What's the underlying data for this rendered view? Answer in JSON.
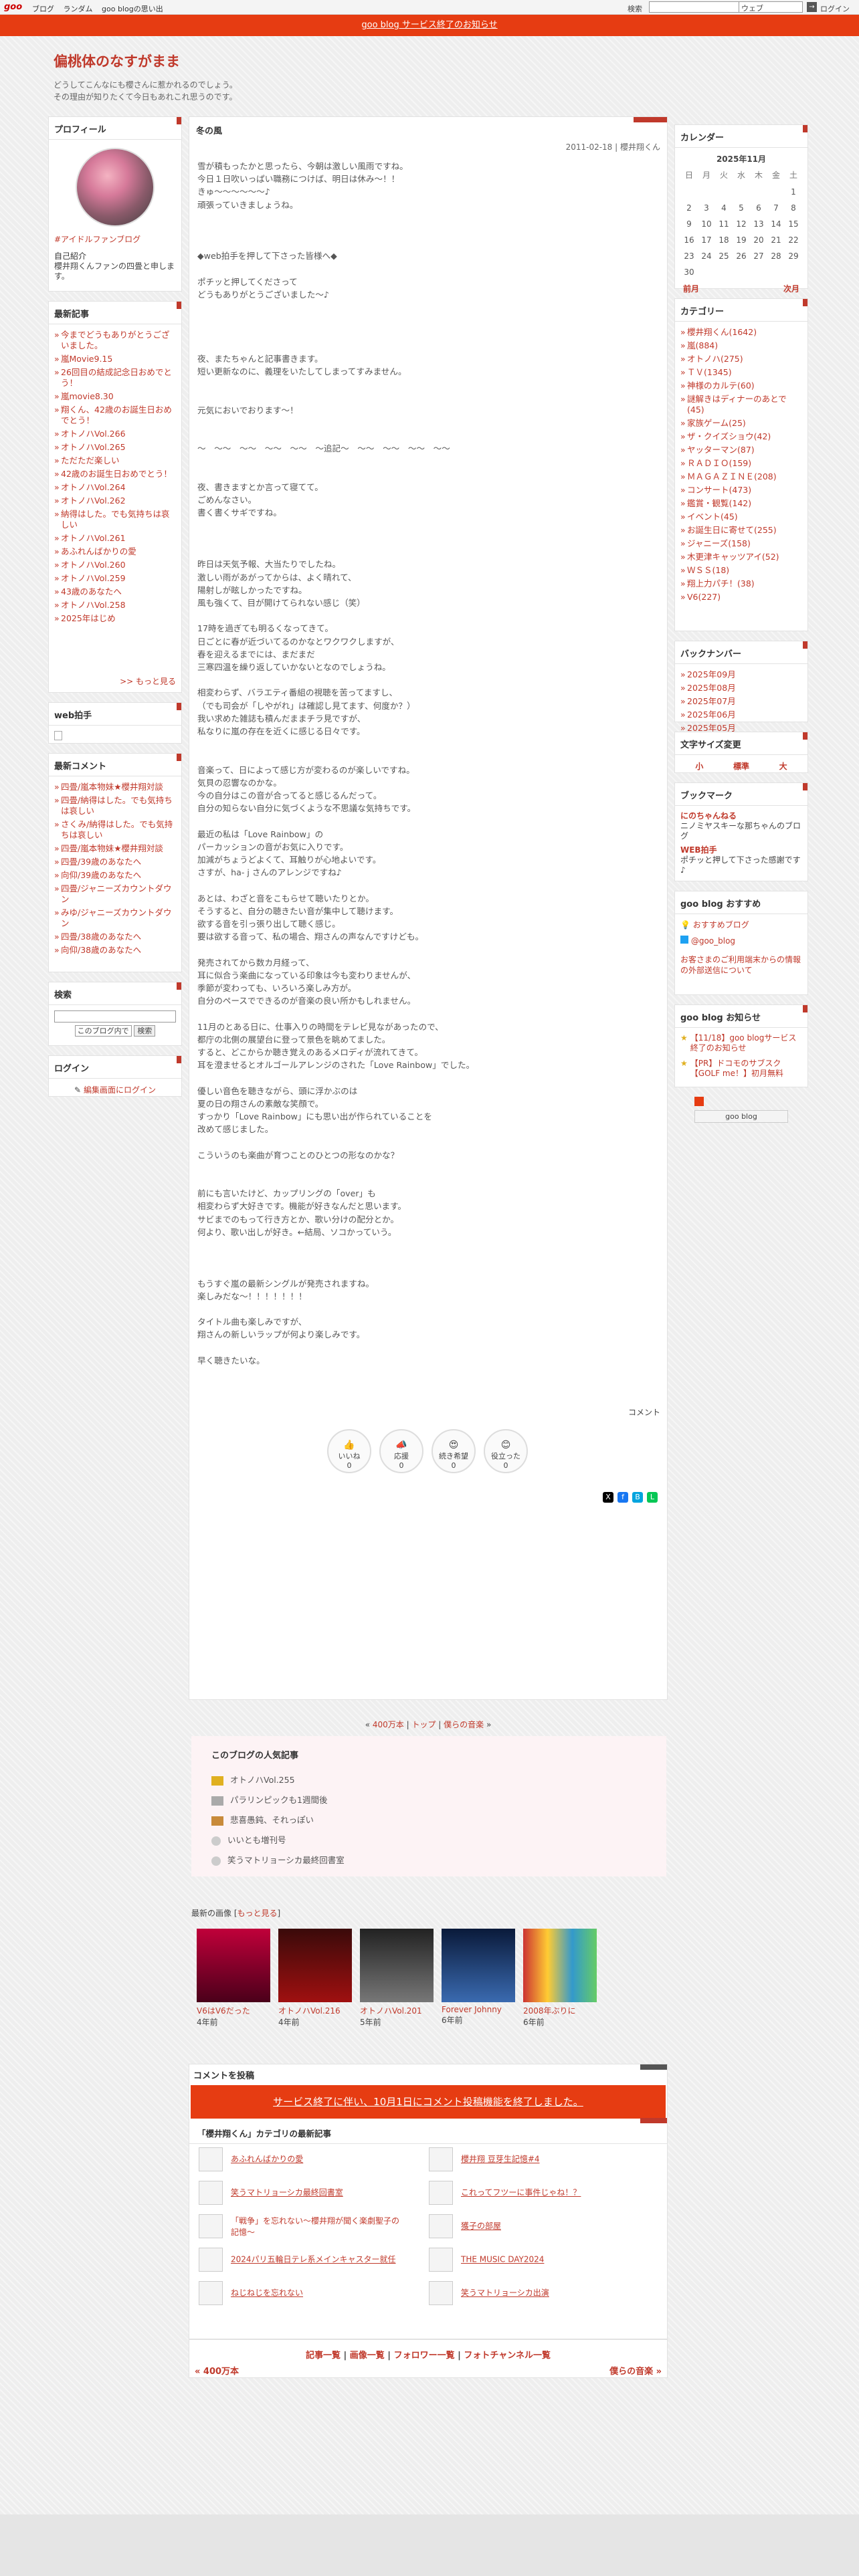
{
  "topbar": {
    "logo": "goo",
    "links": [
      "ブログ",
      "ランダム",
      "goo blogの思い出"
    ],
    "search_label": "検索",
    "search_scope": "ウェブ",
    "go": "→",
    "login": "ログイン"
  },
  "banner": "goo blog サービス終了のお知らせ",
  "blog": {
    "title": "偏桃体のなすがまま",
    "desc1": "どうしてこんなにも櫻さんに惹かれるのでしょう。",
    "desc2": "その理由が知りたくて今日もあれこれ思うのです。"
  },
  "left": {
    "profile": {
      "title": "プロフィール",
      "hashtag": "#アイドルファンブログ",
      "intro_label": "自己紹介",
      "intro": "櫻井翔くんファンの四畳と申します。"
    },
    "recent": {
      "title": "最新記事",
      "items": [
        "今までどうもありがとうございました。",
        "嵐Movie9.15",
        "26回目の結成記念日おめでとう！",
        "嵐movie8.30",
        "翔くん、42歳のお誕生日おめでとう！",
        "オトノハVol.266",
        "オトノハVol.265",
        "ただただ楽しい",
        "42歳のお誕生日おめでとう！",
        "オトノハVol.264",
        "オトノハVol.262",
        "納得はした。でも気持ちは哀しい",
        "オトノハVol.261",
        "あふれんばかりの愛",
        "オトノハVol.260",
        "オトノハVol.259",
        "43歳のあなたへ",
        "オトノハVol.258",
        "2025年はじめ"
      ],
      "more": ">> もっと見る"
    },
    "clap": {
      "title": "web拍手"
    },
    "comments": {
      "title": "最新コメント",
      "items": [
        "四畳/嵐本物妹★櫻井翔対談",
        "四畳/納得はした。でも気持ちは哀しい",
        "さくみ/納得はした。でも気持ちは哀しい",
        "四畳/嵐本物妹★櫻井翔対談",
        "四畳/39歳のあなたへ",
        "向仰/39歳のあなたへ",
        "四畳/ジャニーズカウントダウン",
        "みゆ/ジャニーズカウントダウン",
        "四畳/38歳のあなたへ",
        "向仰/38歳のあなたへ"
      ]
    },
    "search": {
      "title": "検索",
      "scope": "このブログ内で",
      "button": "検索"
    },
    "login": {
      "title": "ログイン",
      "link": "編集画面にログイン"
    }
  },
  "article": {
    "title": "冬の風",
    "date": "2011-02-18 | 櫻井翔くん",
    "body": "雪が積もったかと思ったら、今朝は激しい風雨ですね。\n今日１日吹いっぱい職務につけば、明日は休み〜！！\nきゅ〜〜〜〜〜〜♪\n頑張っていきましょうね。\n\n\n\n◆web拍手を押して下さった皆様へ◆\n\nポチッと押してくださって\nどうもありがとうございました〜♪\n\n\n\n\n夜、またちゃんと記事書きます。\n短い更新なのに、義理をいたしてしまってすみません。\n\n\n元気においでおります〜！\n\n\n〜　〜〜　〜〜　〜〜　〜〜　〜追記〜　〜〜　〜〜　〜〜　〜〜\n\n\n夜、書きますとか言って寝てて。\nごめんなさい。\n書く書くサギですね。\n\n\n\n昨日は天気予報、大当たりでしたね。\n激しい雨があがってからは、よく晴れて、\n陽射しが眩しかったですね。\n風も強くて、目が開けてられない感じ（笑）\n\n17時を過ぎても明るくなってきて。\n日ごとに春が近づいてるのかなとワクワクしますが、\n春を迎えるまでには、まだまだ\n三寒四温を繰り返していかないとなのでしょうね。\n\n相変わらず、バラエティ番組の視聴を苦ってますし、\n（でも司会が「しやがれ」は確認し見てます、何度か？）\n我い求めた雑誌も積んだままチラ見ですが、\n私なりに嵐の存在を近くに感じる日々です。\n\n\n音楽って、日によって感じ方が変わるのが楽しいですね。\n気貝の忍響なのかな。\n今の自分はこの音が合ってると感じるんだって。\n自分の知らない自分に気づくような不思議な気持ちです。\n\n最近の私は「Love Rainbow」の\nパーカッションの音がお気に入りです。\n加減がちょうどよくて、耳触りが心地よいです。\nさすが、ha- j さんのアレンジですね♪\n\nあとは、わざと音をこもらせて聴いたりとか。\nそうすると、自分の聴きたい音が集中して聴けます。\n欲する音を引っ張り出して聴く感じ。\n要は欲する音って、私の場合、翔さんの声なんですけども。\n\n発売されてから数カ月経って、\n耳に似合う楽曲になっている印象は今も変わりませんが、\n季節が変わっても、いろいろ楽しみ方が。\n自分のペースでできるのが音楽の良い所かもしれません。\n\n11月のとある日に、仕事入りの時間をテレビ見ながあったので、\n都庁の北側の展望台に登って景色を眺めてました。\n すると、どこからか聴き覚えのあるメロディが流れてきて。\n耳を澄ませるとオルゴールアレンジのされた「Love Rainbow」でした。\n\n優しい音色を聴きながら、頭に浮かぶのは\n夏の日の翔さんの素敵な笑顔で。\nすっかり「Love Rainbow」にも思い出が作られていることを\n改めて感じました。\n\nこういうのも楽曲が育つことのひとつの形なのかな？\n\n\n前にも言いたけど、カップリングの「over」も\n相変わらず大好きです。機能が好きなんだと思います。\nサビまでのもって行き方とか、歌い分けの配分とか。\n何より、歌い出しが好き。←結局、ソコかっていう。\n\n\n\nもうすぐ嵐の最新シングルが発売されますね。\n楽しみだな〜！！！！！！！\n\nタイトル曲も楽しみですが、\n翔さんの新しいラップが何より楽しみです。\n\n早く聴きたいな。",
    "comment_label": "コメント",
    "reactions": [
      {
        "label": "いいね",
        "count": "0"
      },
      {
        "label": "応援",
        "count": "0"
      },
      {
        "label": "続き希望",
        "count": "0"
      },
      {
        "label": "役立った",
        "count": "0"
      }
    ]
  },
  "right": {
    "calendar": {
      "title": "カレンダー",
      "month": "2025年11月",
      "dow": [
        "日",
        "月",
        "火",
        "水",
        "木",
        "金",
        "土"
      ],
      "prev": "前月",
      "next": "次月",
      "weeks": [
        [
          "",
          "",
          "",
          "",
          "",
          "",
          "1"
        ],
        [
          "2",
          "3",
          "4",
          "5",
          "6",
          "7",
          "8"
        ],
        [
          "9",
          "10",
          "11",
          "12",
          "13",
          "14",
          "15"
        ],
        [
          "16",
          "17",
          "18",
          "19",
          "20",
          "21",
          "22"
        ],
        [
          "23",
          "24",
          "25",
          "26",
          "27",
          "28",
          "29"
        ],
        [
          "30",
          "",
          "",
          "",
          "",
          "",
          ""
        ]
      ]
    },
    "category": {
      "title": "カテゴリー",
      "items": [
        "櫻井翔くん(1642)",
        "嵐(884)",
        "オトノハ(275)",
        "ＴＶ(1345)",
        "神様のカルテ(60)",
        "謎解きはディナーのあとで(45)",
        "家族ゲーム(25)",
        "ザ・クイズショウ(42)",
        "ヤッターマン(87)",
        "ＲＡＤＩＯ(159)",
        "ＭＡＧＡＺＩＮＥ(208)",
        "コンサート(473)",
        "鑑賞・観覧(142)",
        "イベント(45)",
        "お誕生日に寄せて(255)",
        "ジャニーズ(158)",
        "木更津キャッツアイ(52)",
        "ＷＳＳ(18)",
        "翔上力パチ！(38)",
        "V6(227)"
      ]
    },
    "backnumber": {
      "title": "バックナンバー",
      "items": [
        "2025年09月",
        "2025年08月",
        "2025年07月",
        "2025年06月",
        "2025年05月"
      ]
    },
    "fontsize": {
      "title": "文字サイズ変更",
      "small": "小",
      "mid": "標準",
      "large": "大"
    },
    "bookmark": {
      "title": "ブックマーク",
      "name1": "にのちゃんねる",
      "desc1": "ニノミヤスキーな那ちゃんのブログ",
      "name2": "WEB拍手",
      "desc2": "ポチッと押して下さった感謝です♪"
    },
    "recommend": {
      "title": "goo blog おすすめ",
      "item1": "おすすめブログ",
      "item2": "@goo_blog",
      "notice": "お客さまのご利用端末からの情報の外部送信について"
    },
    "news": {
      "title": "goo blog お知らせ",
      "item1": "【11/18】goo blogサービス終了のお知らせ",
      "item2": "【PR】ドコモのサブスク【GOLF me！】初月無料"
    },
    "badge": "goo blog"
  },
  "pager": {
    "prev": "400万本",
    "top": "トップ",
    "next": "僕らの音楽"
  },
  "popular": {
    "title": "このブログの人気記事",
    "items": [
      "オトノハVol.255",
      "パラリンピックも1週間後",
      "悲喜愚鈍、それっぽい",
      "いいとも増刊号",
      "笑うマトリョーシカ最終回書室"
    ]
  },
  "images": {
    "title": "最新の画像",
    "more": "もっと見る",
    "items": [
      {
        "name": "V6はV6だった",
        "age": "4年前"
      },
      {
        "name": "オトノハVol.216",
        "age": "4年前"
      },
      {
        "name": "オトノハVol.201",
        "age": "5年前"
      },
      {
        "name": "Forever Johnny",
        "age": "6年前"
      },
      {
        "name": "2008年ぶりに",
        "age": "6年前"
      }
    ]
  },
  "comment_post": {
    "title": "コメントを投稿",
    "notice": "サービス終了に伴い、10月1日にコメント投稿機能を終了しました。",
    "cat_title": "「櫻井翔くん」カテゴリの最新記事",
    "items": [
      "あふれんばかりの愛",
      "櫻井翔 豆芽生記憶#4",
      "笑うマトリョーシカ最終回書室",
      "これってフツーに事件じゃね！？",
      "「戦争」を忘れない〜櫻井翔が聞く楽劇聖子の記憶〜",
      "獲子の部屋",
      "2024パリ五輪日テレ系メインキャスター就任",
      "THE MUSIC DAY2024",
      "ねじねじを忘れない",
      "笑うマトリョーシカ出演"
    ]
  },
  "footer": {
    "links": [
      "記事一覧",
      "画像一覧",
      "フォロワー一覧",
      "フォトチャンネル一覧"
    ],
    "prev": "« 400万本",
    "next": "僕らの音楽 »"
  }
}
